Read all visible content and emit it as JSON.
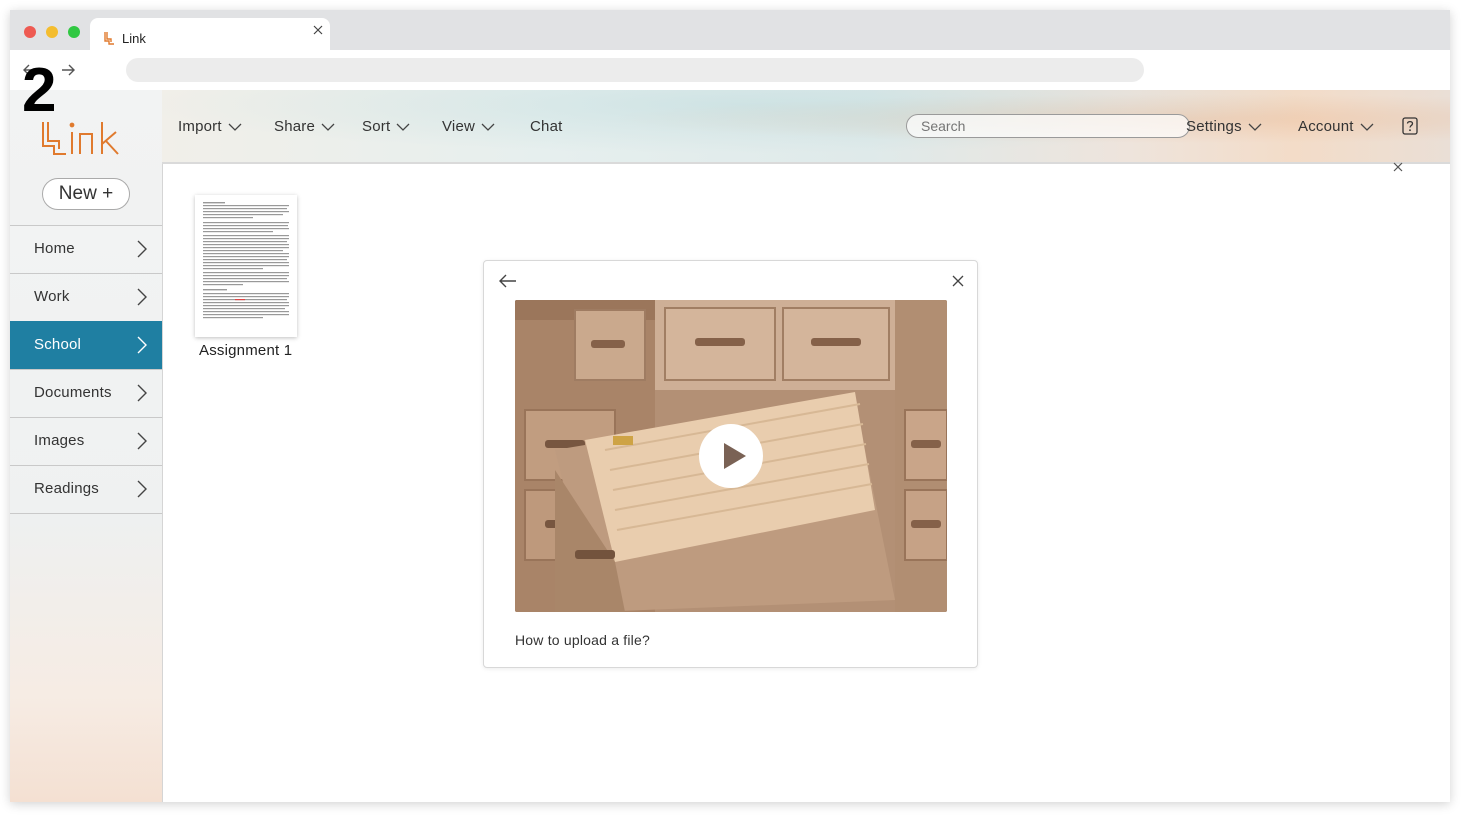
{
  "step_number": "2",
  "browser": {
    "tab_title": "Link"
  },
  "app": {
    "logo_text": "Link",
    "brand_color": "#e07a2e",
    "accent_color": "#1f7fa2"
  },
  "header": {
    "menu": [
      {
        "label": "Import",
        "has_dropdown": true
      },
      {
        "label": "Share",
        "has_dropdown": true
      },
      {
        "label": "Sort",
        "has_dropdown": true
      },
      {
        "label": "View",
        "has_dropdown": true
      },
      {
        "label": "Chat",
        "has_dropdown": false
      }
    ],
    "search_placeholder": "Search",
    "settings_label": "Settings",
    "account_label": "Account",
    "help_icon": "question-icon"
  },
  "sidebar": {
    "new_button_label": "New +",
    "items": [
      {
        "label": "Home",
        "active": false
      },
      {
        "label": "Work",
        "active": false
      },
      {
        "label": "School",
        "active": true
      },
      {
        "label": "Documents",
        "active": false
      },
      {
        "label": "Images",
        "active": false
      },
      {
        "label": "Readings",
        "active": false
      }
    ]
  },
  "files": [
    {
      "name": "Assignment 1",
      "type": "document"
    }
  ],
  "video_modal": {
    "caption": "How to upload a file?",
    "thumbnail": "file-cabinet-drawer-image",
    "tint_color": "#e8a06a"
  }
}
